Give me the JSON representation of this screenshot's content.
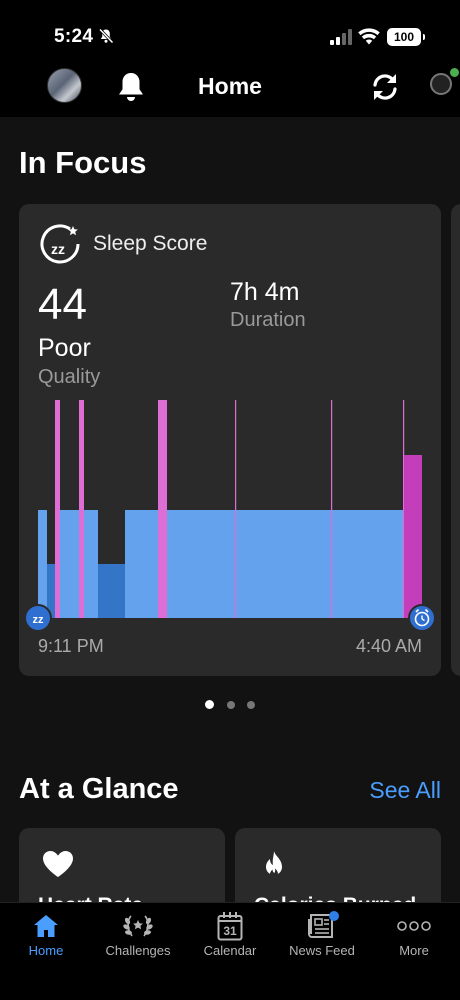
{
  "status_bar": {
    "time": "5:24",
    "battery": "100"
  },
  "header": {
    "title": "Home"
  },
  "in_focus": {
    "heading": "In Focus"
  },
  "sleep_card": {
    "title": "Sleep Score",
    "score": "44",
    "quality_value": "Poor",
    "quality_label": "Quality",
    "duration_value": "7h 4m",
    "duration_label": "Duration",
    "start_time": "9:11 PM",
    "end_time": "4:40 AM"
  },
  "chart_data": {
    "type": "bar",
    "x_range": [
      "9:11 PM",
      "4:40 AM"
    ],
    "stage_colors": {
      "deep": "#3575c8",
      "light": "#64a2ee",
      "rem": "#dd6ed5",
      "awake": "#c43dba"
    }
  },
  "carousel": {
    "pages": 3,
    "active": 0
  },
  "at_a_glance": {
    "heading": "At a Glance",
    "see_all": "See All",
    "cards": [
      "Heart Rate",
      "Calories Burned"
    ]
  },
  "tabs": [
    {
      "label": "Home",
      "active": true
    },
    {
      "label": "Challenges"
    },
    {
      "label": "Calendar"
    },
    {
      "label": "News Feed"
    },
    {
      "label": "More"
    }
  ],
  "calendar_day": "31",
  "colors": {
    "accent": "#4a9eff",
    "background": "#121212",
    "card": "#2a2a2a"
  }
}
